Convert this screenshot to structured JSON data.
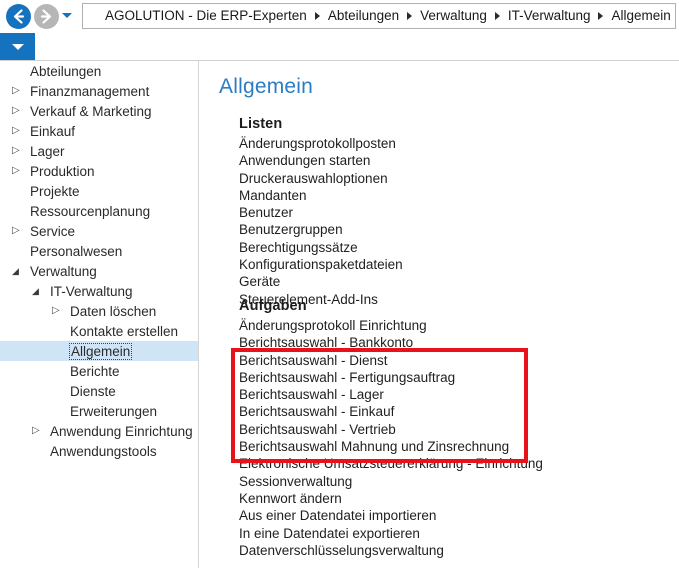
{
  "window": {
    "title": "Allgemein"
  },
  "navbar": {
    "back_icon": "arrow-left-icon",
    "forward_icon": "arrow-right-icon",
    "history_dropdown_icon": "chevron-down-icon",
    "breadcrumb": [
      "AGOLUTION - Die ERP-Experten",
      "Abteilungen",
      "Verwaltung",
      "IT-Verwaltung",
      "Allgemein"
    ]
  },
  "ribbon": {
    "dropdown_icon": "chevron-down-icon"
  },
  "sidebar": {
    "items": [
      {
        "label": "Abteilungen",
        "level": 0,
        "expander": "none",
        "selected": false
      },
      {
        "label": "Finanzmanagement",
        "level": 0,
        "expander": "collapsed",
        "selected": false
      },
      {
        "label": "Verkauf & Marketing",
        "level": 0,
        "expander": "collapsed",
        "selected": false
      },
      {
        "label": "Einkauf",
        "level": 0,
        "expander": "collapsed",
        "selected": false
      },
      {
        "label": "Lager",
        "level": 0,
        "expander": "collapsed",
        "selected": false
      },
      {
        "label": "Produktion",
        "level": 0,
        "expander": "collapsed",
        "selected": false
      },
      {
        "label": "Projekte",
        "level": 0,
        "expander": "none",
        "selected": false
      },
      {
        "label": "Ressourcenplanung",
        "level": 0,
        "expander": "none",
        "selected": false
      },
      {
        "label": "Service",
        "level": 0,
        "expander": "collapsed",
        "selected": false
      },
      {
        "label": "Personalwesen",
        "level": 0,
        "expander": "none",
        "selected": false
      },
      {
        "label": "Verwaltung",
        "level": 0,
        "expander": "expanded",
        "selected": false
      },
      {
        "label": "IT-Verwaltung",
        "level": 1,
        "expander": "expanded",
        "selected": false
      },
      {
        "label": "Daten löschen",
        "level": 2,
        "expander": "collapsed",
        "selected": false
      },
      {
        "label": "Kontakte erstellen",
        "level": 2,
        "expander": "none",
        "selected": false
      },
      {
        "label": "Allgemein",
        "level": 2,
        "expander": "none",
        "selected": true
      },
      {
        "label": "Berichte",
        "level": 2,
        "expander": "none",
        "selected": false
      },
      {
        "label": "Dienste",
        "level": 2,
        "expander": "none",
        "selected": false
      },
      {
        "label": "Erweiterungen",
        "level": 2,
        "expander": "none",
        "selected": false
      },
      {
        "label": "Anwendung Einrichtung",
        "level": 1,
        "expander": "collapsed",
        "selected": false
      },
      {
        "label": "Anwendungstools",
        "level": 1,
        "expander": "none",
        "selected": false
      }
    ]
  },
  "content": {
    "page_title": "Allgemein",
    "sections": [
      {
        "title": "Listen",
        "items": [
          "Änderungsprotokollposten",
          "Anwendungen starten",
          "Druckerauswahloptionen",
          "Mandanten",
          "Benutzer",
          "Benutzergruppen",
          "Berechtigungssätze",
          "Konfigurationspaketdateien",
          "Geräte",
          "Steuerelement-Add-Ins"
        ]
      },
      {
        "title": "Aufgaben",
        "items": [
          "Änderungsprotokoll Einrichtung",
          "Berichtsauswahl - Bankkonto",
          "Berichtsauswahl - Dienst",
          "Berichtsauswahl - Fertigungsauftrag",
          "Berichtsauswahl - Lager",
          "Berichtsauswahl - Einkauf",
          "Berichtsauswahl - Vertrieb",
          "Berichtsauswahl Mahnung und Zinsrechnung",
          "Elektronische Umsatzsteuererklärung - Einrichtung",
          "Sessionverwaltung",
          "Kennwort ändern",
          "Aus einer Datendatei importieren",
          "In eine Datendatei exportieren",
          "Datenverschlüsselungsverwaltung"
        ]
      }
    ]
  },
  "annotation": {
    "highlight_color": "#e8131a",
    "highlighted_items": [
      "Berichtsauswahl - Bankkonto",
      "Berichtsauswahl - Dienst",
      "Berichtsauswahl - Fertigungsauftrag",
      "Berichtsauswahl - Lager",
      "Berichtsauswahl - Einkauf",
      "Berichtsauswahl - Vertrieb",
      "Berichtsauswahl Mahnung und Zinsrechnung"
    ]
  },
  "colors": {
    "accent_blue": "#1572be",
    "title_blue": "#2b7cc4",
    "selection_blue": "#cfe4f7",
    "annotation_red": "#e8131a"
  }
}
